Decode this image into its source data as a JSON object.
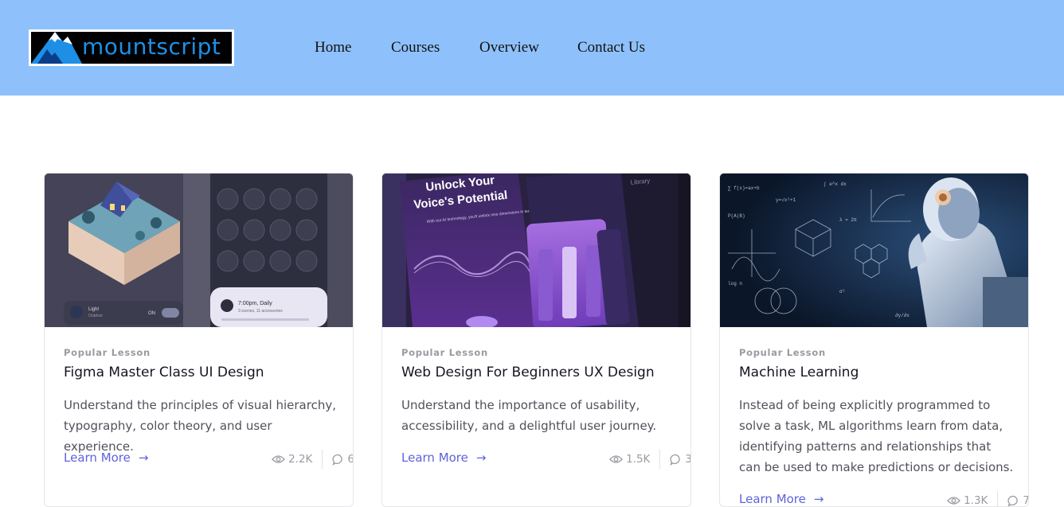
{
  "header": {
    "logo_text": "mountscript",
    "nav": [
      "Home",
      "Courses",
      "Overview",
      "Contact Us"
    ]
  },
  "cards": [
    {
      "tag": "Popular Lesson",
      "title": "Figma Master Class UI Design",
      "description": "Understand the principles of visual hierarchy, typography, color theory, and user experience.",
      "link": "Learn More",
      "views": "2.2K",
      "comments": "6",
      "image": {
        "time": "7:00pm, Daily",
        "scenes": "3 scenes, 11 accessories",
        "light_label": "Light",
        "light_sub": "Outdoor",
        "toggle": "ON"
      }
    },
    {
      "tag": "Popular Lesson",
      "title": "Web Design For Beginners UX Design",
      "description": "Understand the importance of usability, accessibility, and a delightful user journey.",
      "link": "Learn More",
      "views": "1.5K",
      "comments": "3",
      "image": {
        "headline1": "Unlock Your",
        "headline2": "Voice's Potential",
        "sub": "With our AI technology, you'll unlock new dimensions in audio quality and efficiency.",
        "library": "Library"
      }
    },
    {
      "tag": "Popular Lesson",
      "title": "Machine Learning",
      "description": "Instead of being explicitly programmed to solve a task, ML algorithms learn from data, identifying patterns and relationships that can be used to make predictions or decisions.",
      "link": "Learn More",
      "views": "1.3K",
      "comments": "7"
    }
  ],
  "colors": {
    "header_bg": "#8ec1fb",
    "link": "#5e63d9",
    "logo_text": "#1d8fe6"
  },
  "icons": [
    "eye-icon",
    "comment-icon",
    "arrow-right-icon",
    "mountain-logo-icon"
  ]
}
